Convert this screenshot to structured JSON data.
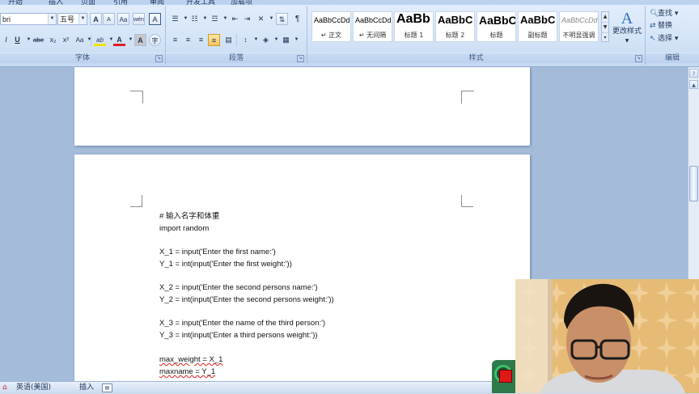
{
  "ribbon": {
    "font_group": {
      "font_name": "bri",
      "font_size": "五号",
      "label": "字体",
      "grow_label": "A",
      "shrink_label": "A",
      "clear_label": "Aa",
      "phonetic_label": "wén",
      "border_char_label": "A",
      "bold_label": "I",
      "underline_label": "U",
      "strike_label": "abe",
      "subscript_label": "x₂",
      "superscript_label": "x²",
      "case_label": "Aa",
      "highlight_label": "ab",
      "color_label": "A",
      "shade_label": "A",
      "enclose_label": "字"
    },
    "paragraph_group": {
      "label": "段落"
    },
    "styles_group": {
      "label": "样式",
      "tiles": [
        {
          "sample": "AaBbCcDd",
          "name": "↵ 正文"
        },
        {
          "sample": "AaBbCcDd",
          "name": "↵ 无间隔"
        },
        {
          "sample": "AaBb",
          "name": "标题 1"
        },
        {
          "sample": "AaBbC",
          "name": "标题 2"
        },
        {
          "sample": "AaBbC",
          "name": "标题"
        },
        {
          "sample": "AaBbC",
          "name": "副标题"
        },
        {
          "sample": "AaBbCcDd",
          "name": "不明显强调"
        }
      ],
      "change_styles_label": "更改样式",
      "change_styles_icon": "A"
    },
    "editing_group": {
      "label": "编辑",
      "find": "查找 ▾",
      "replace": "替换",
      "select": "选择 ▾"
    }
  },
  "document": {
    "lines": [
      "# 输入名字和体重",
      "import random",
      "X_1 = input('Enter the first name:')",
      "Y_1 = int(input('Enter  the first weight:'))",
      "X_2 = input('Enter the second persons name:')",
      "Y_2 = int(input('Enter  the second persons weight:'))",
      "X_3 = input('Enter the name of the third person:')",
      "Y_3 = int(input('Enter  a third persons weight:'))",
      "max_weight = X_1",
      "maxname = Y_1"
    ]
  },
  "statusbar": {
    "language": "英语(美国)",
    "insert_mode": "插入"
  },
  "colors": {
    "ribbon_bg": "#d4e4f7",
    "doc_bg": "#a4bcd9",
    "recorder_stop": "#e01818",
    "font_color_bar": "#e02020",
    "highlight_bar": "#f2e200"
  }
}
